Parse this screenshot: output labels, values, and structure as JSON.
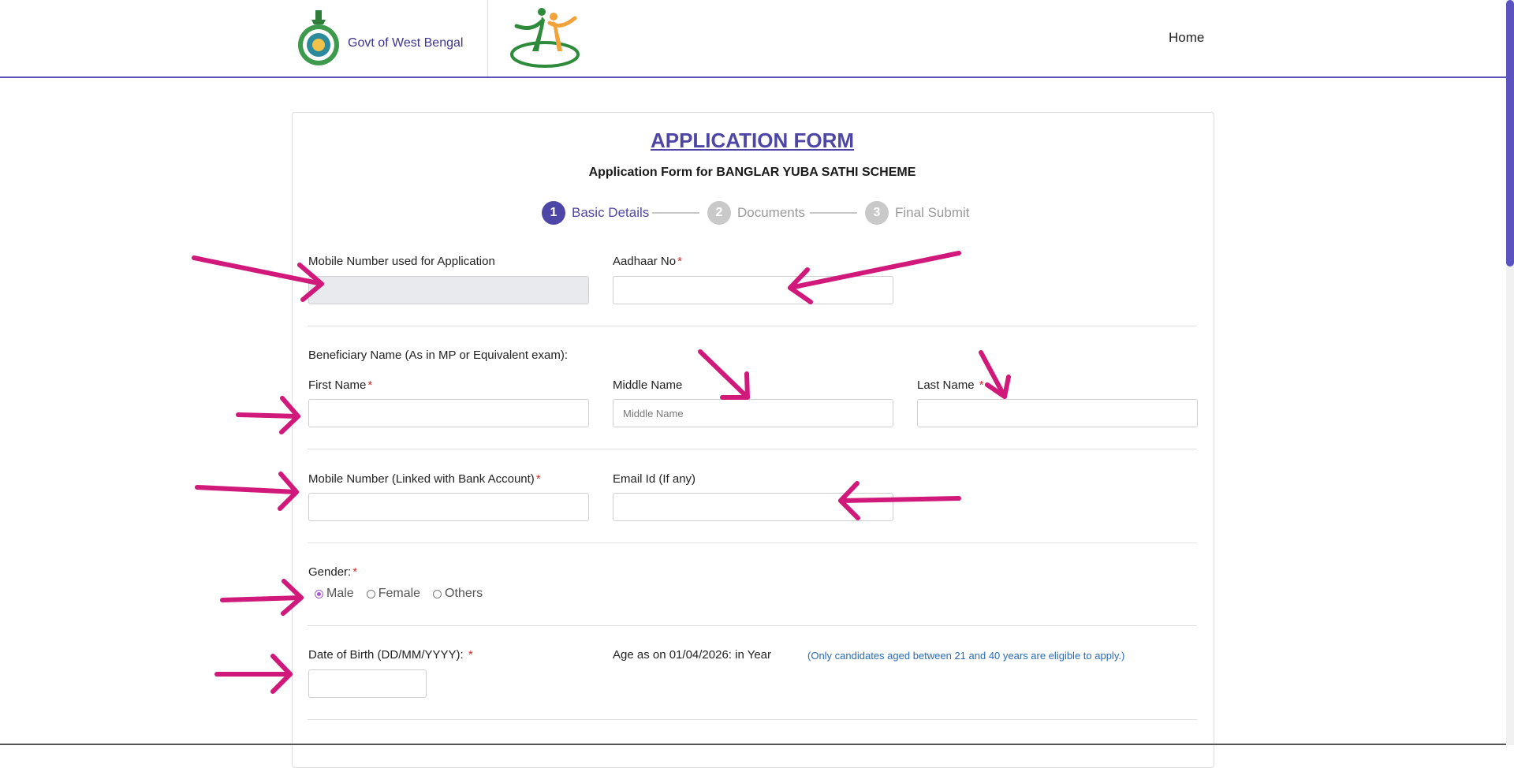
{
  "header": {
    "govt_name": "Govt of West Bengal",
    "nav_home": "Home"
  },
  "form": {
    "title": "APPLICATION FORM",
    "subtitle": "Application Form for BANGLAR YUBA SATHI SCHEME",
    "steps": [
      {
        "num": "1",
        "label": "Basic Details",
        "state": "active"
      },
      {
        "num": "2",
        "label": "Documents",
        "state": "inactive"
      },
      {
        "num": "3",
        "label": "Final Submit",
        "state": "inactive"
      }
    ],
    "mobile_app_label": "Mobile Number used for Application",
    "mobile_app_value": "",
    "aadhaar_label": "Aadhaar No",
    "aadhaar_value": "",
    "beneficiary_heading": "Beneficiary Name (As in MP or Equivalent exam):",
    "first_name_label": "First Name",
    "first_name_value": "",
    "middle_name_label": "Middle Name",
    "middle_name_placeholder": "Middle Name",
    "last_name_label": "Last Name",
    "last_name_value": "",
    "mobile_bank_label": "Mobile Number (Linked with Bank Account)",
    "mobile_bank_value": "",
    "email_label": "Email Id (If any)",
    "email_value": "",
    "gender_label": "Gender:",
    "gender_options": [
      "Male",
      "Female",
      "Others"
    ],
    "gender_selected": "Male",
    "dob_label": "Date of Birth (DD/MM/YYYY):",
    "dob_value": "",
    "age_label": "Age as on 01/04/2026: in Year",
    "age_note": "(Only candidates aged between 21 and 40 years are eligible to apply.)",
    "required_marker": "*"
  },
  "colors": {
    "primary": "#4e46a6",
    "required": "#d32f2f",
    "annotation_arrow": "#d0197a",
    "note": "#2a6cb8"
  }
}
